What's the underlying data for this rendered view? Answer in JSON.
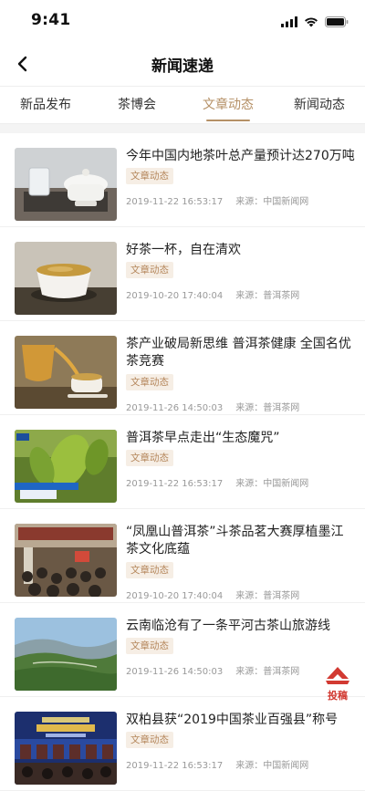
{
  "status": {
    "time": "9:41"
  },
  "nav": {
    "title": "新闻速递"
  },
  "tabs": [
    {
      "label": "新品发布"
    },
    {
      "label": "茶博会"
    },
    {
      "label": "文章动态"
    },
    {
      "label": "新闻动态"
    }
  ],
  "articles": [
    {
      "title": "今年中国内地茶叶总产量预计达270万吨",
      "tag": "文章动态",
      "date": "2019-11-22 16:53:17",
      "source": "来源：中国新闻网"
    },
    {
      "title": "好茶一杯，自在清欢",
      "tag": "文章动态",
      "date": "2019-10-20 17:40:04",
      "source": "来源：普洱茶网"
    },
    {
      "title": "茶产业破局新思维 普洱茶健康 全国名优茶竞赛",
      "tag": "文章动态",
      "date": "2019-11-26 14:50:03",
      "source": "来源：普洱茶网"
    },
    {
      "title": "普洱茶早点走出“生态魔咒”",
      "tag": "文章动态",
      "date": "2019-11-22 16:53:17",
      "source": "来源：中国新闻网"
    },
    {
      "title": "“凤凰山普洱茶”斗茶品茗大赛厚植墨江茶文化底蕴",
      "tag": "文章动态",
      "date": "2019-10-20 17:40:04",
      "source": "来源：普洱茶网"
    },
    {
      "title": "云南临沧有了一条平河古茶山旅游线",
      "tag": "文章动态",
      "date": "2019-11-26 14:50:03",
      "source": "来源：普洱茶网"
    },
    {
      "title": "双柏县获“2019中国茶业百强县”称号",
      "tag": "文章动态",
      "date": "2019-11-22 16:53:17",
      "source": "来源：中国新闻网"
    }
  ],
  "fab": {
    "label": "投稿"
  },
  "colors": {
    "accent": "#b59066",
    "tag_text": "#b5875c",
    "tag_bg": "#f6eee5",
    "fab_red": "#d23a32"
  }
}
